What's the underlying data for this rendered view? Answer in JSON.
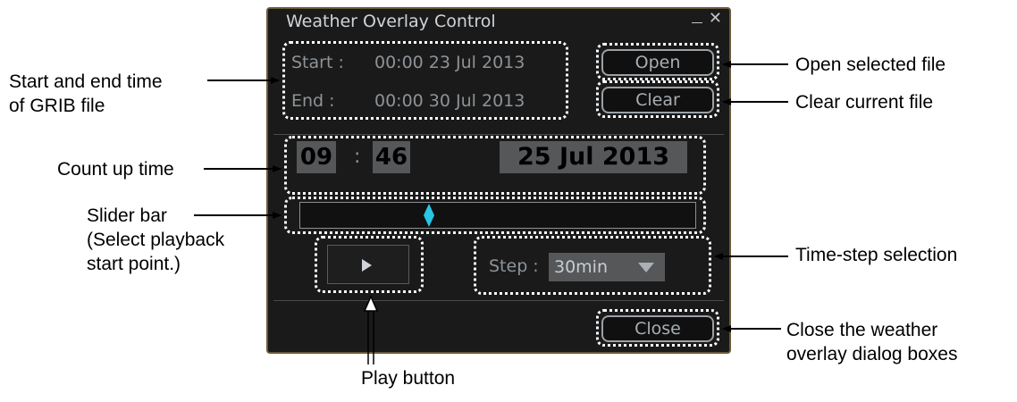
{
  "dialog": {
    "title": "Weather Overlay Control",
    "start_label": "Start :",
    "start_value": "00:00  23 Jul 2013",
    "end_label": "End :",
    "end_value": "00:00  30 Jul 2013",
    "open_label": "Open",
    "clear_label": "Clear",
    "hour": "09",
    "time_sep": ":",
    "minute": "46",
    "date": "25 Jul 2013",
    "slider_position": 0.32,
    "step_label": "Step :",
    "step_value": "30min",
    "close_label": "Close"
  },
  "callouts": {
    "start_end_line1": "Start and end time",
    "start_end_line2": "of GRIB file",
    "count_up": "Count up time",
    "slider_line1": "Slider bar",
    "slider_line2": "(Select playback",
    "slider_line3": "start point.)",
    "play": "Play button",
    "open": "Open selected file",
    "clear": "Clear current file",
    "time_step": "Time-step selection",
    "close_line1": "Close the weather",
    "close_line2": "overlay dialog boxes"
  },
  "colors": {
    "dialog_bg": "#1a1a1a",
    "slider_thumb": "#29c5e6",
    "callout_border": "#ffffff"
  }
}
